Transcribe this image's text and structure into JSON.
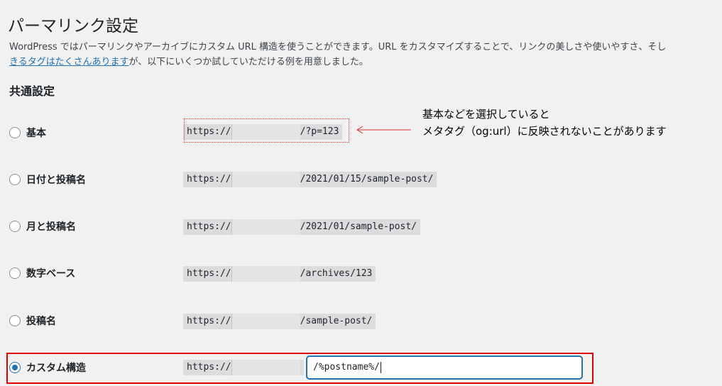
{
  "page": {
    "title": "パーマリンク設定",
    "intro_line1": "WordPress ではパーマリンクやアーカイブにカスタム URL 構造を使うことができます。URL をカスタマイズすることで、リンクの美しさや使いやすさ、そし",
    "intro_link": "きるタグはたくさんあります",
    "intro_line2_rest": "が、以下にいくつか試していただける例を用意しました。",
    "section_title": "共通設定"
  },
  "options": [
    {
      "label": "基本",
      "prefix": "https://",
      "suffix": "/?p=123",
      "checked": false
    },
    {
      "label": "日付と投稿名",
      "prefix": "https://",
      "suffix": "/2021/01/15/sample-post/",
      "checked": false
    },
    {
      "label": "月と投稿名",
      "prefix": "https://",
      "suffix": "/2021/01/sample-post/",
      "checked": false
    },
    {
      "label": "数字ベース",
      "prefix": "https://",
      "suffix": "/archives/123",
      "checked": false
    },
    {
      "label": "投稿名",
      "prefix": "https://",
      "suffix": "/sample-post/",
      "checked": false
    },
    {
      "label": "カスタム構造",
      "prefix": "https://",
      "suffix": "",
      "checked": true
    }
  ],
  "custom_structure_value": "/%postname%/",
  "annotation": {
    "line1": "基本などを選択していると",
    "line2": "メタタグ（og:url）に反映されないことがあります"
  },
  "colors": {
    "accent": "#2271b1",
    "highlight_red": "#e00000",
    "background": "#f1f1f1"
  }
}
